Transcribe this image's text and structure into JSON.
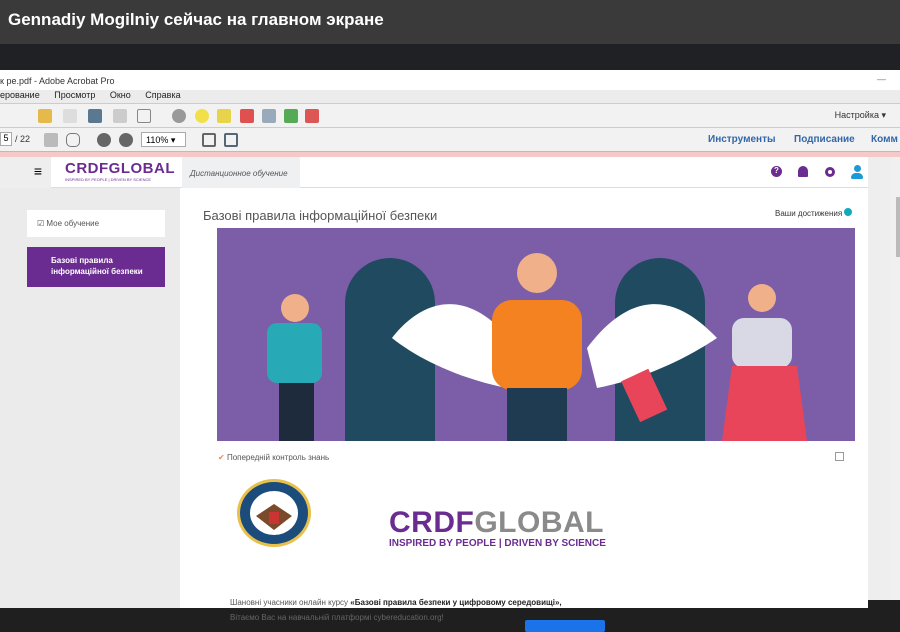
{
  "meet": {
    "title": "Gennadiy Mogilniy сейчас на главном экране"
  },
  "acrobat": {
    "window_title": "к pe.pdf - Adobe Acrobat Pro",
    "menu": [
      "ерование",
      "Просмотр",
      "Окно",
      "Справка"
    ],
    "customize": "Настройка",
    "page_current": "5",
    "page_total": "/ 22",
    "zoom": "110%",
    "tabs": [
      "Инструменты",
      "Подписание",
      "Комм"
    ]
  },
  "site": {
    "logo": "CRDFGLOBAL",
    "logo_tagline": "INSPIRED BY PEOPLE | DRIVEN BY SCIENCE",
    "nav_tab": "Дистанционное обучение",
    "sidebar": [
      "Мое обучение",
      "Базові правила інформаційної безпеки"
    ],
    "page_title": "Базові правила інформаційної безпеки",
    "achievements": "Ваши достижения",
    "activity": "Попередній контроль знань",
    "crdf_big": "CRDFGLOBAL",
    "crdf_big_tagline": "INSPIRED BY PEOPLE | DRIVEN BY SCIENCE",
    "greeting_prefix": "Шановні учасники онлайн курсу ",
    "greeting_course": "«Базові правила безпеки у цифровому середовищі»,",
    "greeting_line2": "Вітаємо Вас на навчальній платформі cybereducation.org!"
  },
  "colors": {
    "purple": "#6b2c91",
    "banner": "#7b5ea7"
  }
}
